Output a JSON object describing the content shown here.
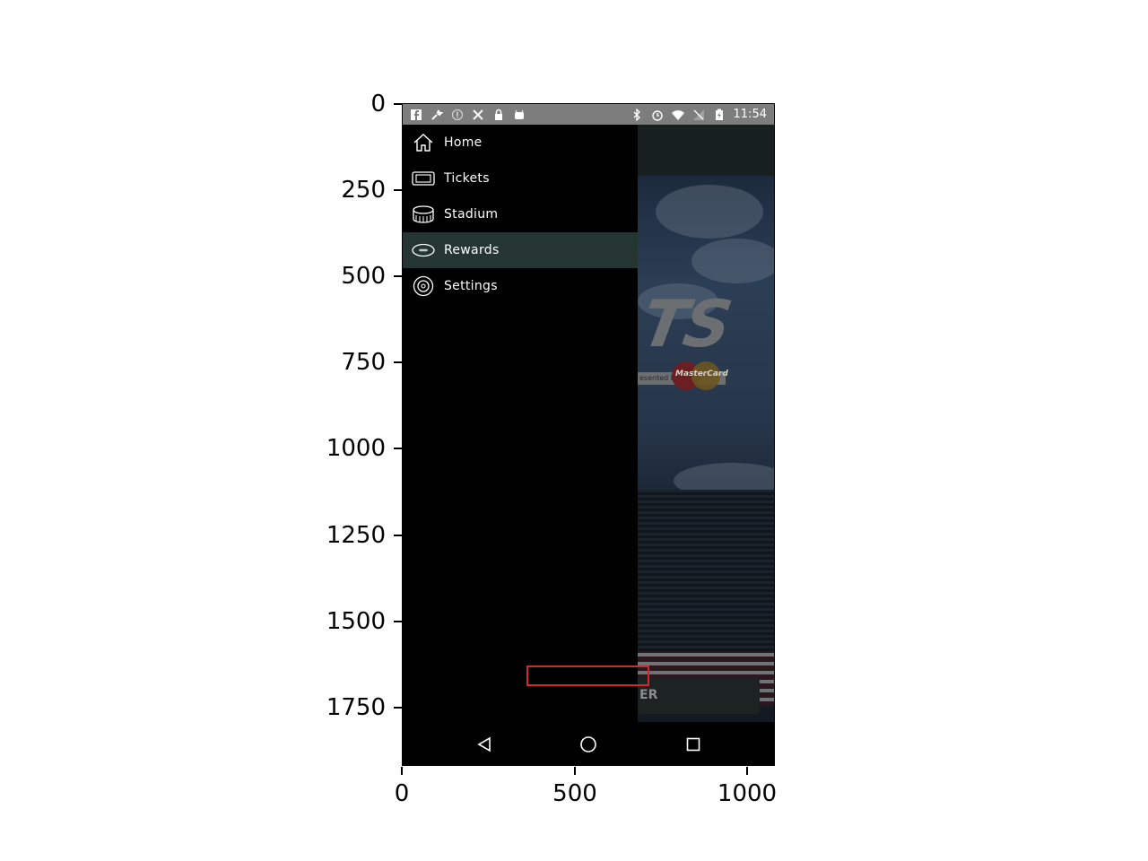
{
  "status_bar": {
    "time": "11:54",
    "left_icons": [
      "facebook-icon",
      "wrench-icon",
      "info-icon",
      "tools-icon",
      "lock-icon",
      "android-icon"
    ],
    "right_icons": [
      "bluetooth-icon",
      "alarm-icon",
      "wifi-icon",
      "no-signal-icon",
      "battery-charging-icon"
    ]
  },
  "drawer": {
    "items": [
      {
        "label": "Home",
        "icon": "home-icon",
        "active": false
      },
      {
        "label": "Tickets",
        "icon": "ticket-icon",
        "active": false
      },
      {
        "label": "Stadium",
        "icon": "stadium-icon",
        "active": false
      },
      {
        "label": "Rewards",
        "icon": "football-icon",
        "active": true
      },
      {
        "label": "Settings",
        "icon": "settings-icon",
        "active": false
      }
    ],
    "active_color": "#243532"
  },
  "background": {
    "logo_fragment": "TS",
    "presented_text": "esented by",
    "card_brand": "MasterCard",
    "button_fragment": "ER"
  },
  "nav_bar": {
    "buttons": [
      "back-icon",
      "home-circle-icon",
      "recents-icon"
    ]
  },
  "axes": {
    "y_ticks": [
      "0",
      "250",
      "500",
      "750",
      "1000",
      "1250",
      "1500",
      "1750"
    ],
    "x_ticks": [
      "0",
      "500",
      "1000"
    ]
  },
  "highlight": {
    "color": "#d62728"
  }
}
